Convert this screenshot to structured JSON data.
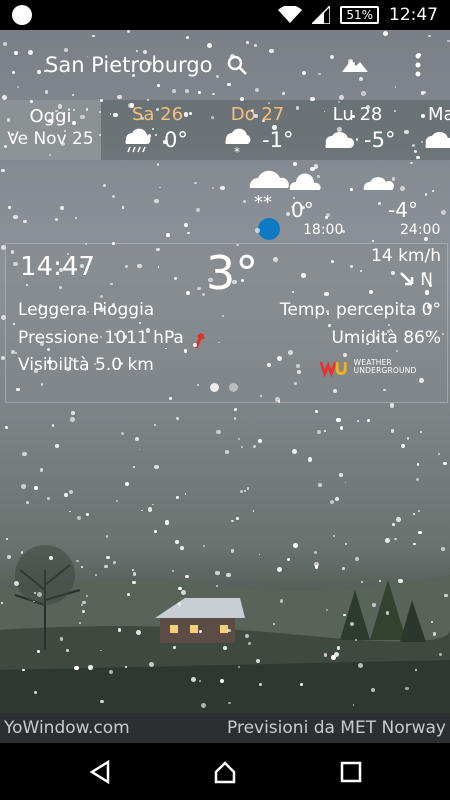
{
  "status_bar": {
    "battery": "51%",
    "time": "12:47"
  },
  "header": {
    "city": "San Pietroburgo"
  },
  "forecast_days": [
    {
      "name": "Oggi",
      "date": "Ve Nov 25"
    },
    {
      "name": "Sa 26",
      "temp": "0°",
      "color": "#f5c07d"
    },
    {
      "name": "Do 27",
      "temp": "-1°",
      "color": "#f5c07d"
    },
    {
      "name": "Lu 28",
      "temp": "-5°"
    },
    {
      "name": "Ma"
    }
  ],
  "hourly": [
    {
      "temp": "0°",
      "time": "18:00"
    },
    {
      "temp": "-4°",
      "time": "24:00"
    }
  ],
  "current": {
    "time": "14:47",
    "temperature": "3°",
    "wind_speed": "14 km/h",
    "wind_direction": "N",
    "condition": "Leggera Pioggia",
    "feels_like": "Temp. percepita 0°",
    "pressure": "Pressione 1011 hPa",
    "humidity": "Umidità 86%",
    "visibility": "Visibilità 5.0 km",
    "provider_logo_text": "WEATHER UNDERGROUND"
  },
  "footer": {
    "left": "YoWindow.com",
    "right": "Previsioni da MET Norway"
  },
  "colors": {
    "accent": "#0e7ac4",
    "weekend": "#f5c07d",
    "pressure_arrow": "#e0302a"
  }
}
